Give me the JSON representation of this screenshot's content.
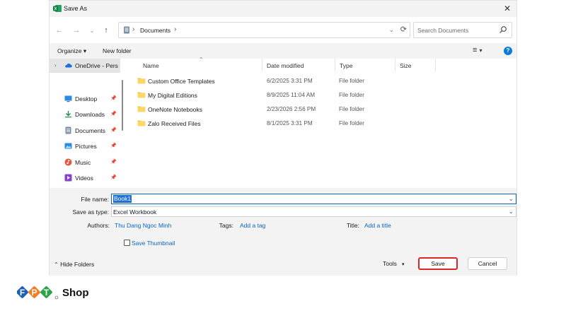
{
  "window": {
    "title": "Save As",
    "close_glyph": "✕"
  },
  "nav": {
    "back": "←",
    "forward": "→",
    "recent": "⌄",
    "up": "↑",
    "breadcrumb": [
      "Documents"
    ],
    "search_placeholder": "Search Documents"
  },
  "toolbar": {
    "organize_label": "Organize ▾",
    "new_folder_label": "New folder",
    "help": "?"
  },
  "sidebar": {
    "items": [
      {
        "label": "OneDrive - Pers",
        "icon": "cloud-icon"
      },
      {
        "label": "Desktop",
        "icon": "desktop-icon"
      },
      {
        "label": "Downloads",
        "icon": "download-icon"
      },
      {
        "label": "Documents",
        "icon": "document-icon"
      },
      {
        "label": "Pictures",
        "icon": "pictures-icon"
      },
      {
        "label": "Music",
        "icon": "music-icon"
      },
      {
        "label": "Videos",
        "icon": "video-icon"
      }
    ]
  },
  "columns": {
    "name": "Name",
    "date": "Date modified",
    "type": "Type",
    "size": "Size"
  },
  "files": [
    {
      "name": "Custom Office Templates",
      "date": "6/2/2025 3:31 PM",
      "type": "File folder"
    },
    {
      "name": "My Digital Editions",
      "date": "8/9/2025 11:04 AM",
      "type": "File folder"
    },
    {
      "name": "OneNote Notebooks",
      "date": "2/23/2026 2:56 PM",
      "type": "File folder"
    },
    {
      "name": "Zalo Received Files",
      "date": "8/1/2025 3:31 PM",
      "type": "File folder"
    }
  ],
  "form": {
    "file_name_label": "File name:",
    "file_name_value": "Book1",
    "save_type_label": "Save as type:",
    "save_type_value": "Excel Workbook",
    "authors_label": "Authors:",
    "authors_value": "Thu Dang Ngoc Minh",
    "tags_label": "Tags:",
    "tags_value": "Add a tag",
    "title_label": "Title:",
    "title_value": "Add a title",
    "thumbnail_label": "Save Thumbnail"
  },
  "footer": {
    "hide_folders": "Hide Folders",
    "tools": "Tools",
    "save": "Save",
    "cancel": "Cancel"
  },
  "brand": {
    "logo_text": "FPT",
    "shop": "Shop"
  },
  "colors": {
    "accent": "#0a64c2",
    "highlight_border": "#d62828",
    "folder": "#f5c542",
    "link": "#0b63c4"
  }
}
